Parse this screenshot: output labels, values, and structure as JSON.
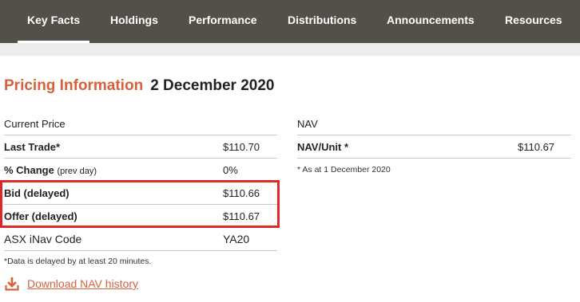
{
  "nav": {
    "tabs": [
      {
        "label": "Key Facts",
        "active": true
      },
      {
        "label": "Holdings"
      },
      {
        "label": "Performance"
      },
      {
        "label": "Distributions"
      },
      {
        "label": "Announcements"
      },
      {
        "label": "Resources"
      }
    ]
  },
  "heading": {
    "title": "Pricing Information",
    "date": "2 December 2020"
  },
  "pricing": {
    "header": "Current Price",
    "last_trade": {
      "label": "Last Trade*",
      "value": "$110.70"
    },
    "pct_change": {
      "label": "% Change",
      "sublabel": "(prev day)",
      "value": "0%"
    },
    "bid": {
      "label": "Bid (delayed)",
      "value": "$110.66"
    },
    "offer": {
      "label": "Offer (delayed)",
      "value": "$110.67"
    },
    "inav": {
      "label": "ASX iNav Code",
      "value": "YA20"
    },
    "note": "*Data is delayed by at least 20 minutes."
  },
  "nav_panel": {
    "header": "NAV",
    "nav_unit": {
      "label": "NAV/Unit *",
      "value": "$110.67"
    },
    "note": "* As at 1 December 2020"
  },
  "download": {
    "label": "Download NAV history",
    "icon": "download-icon"
  },
  "colors": {
    "nav_bg": "#535049",
    "accent": "#d9603b",
    "highlight_box": "#e02626"
  }
}
